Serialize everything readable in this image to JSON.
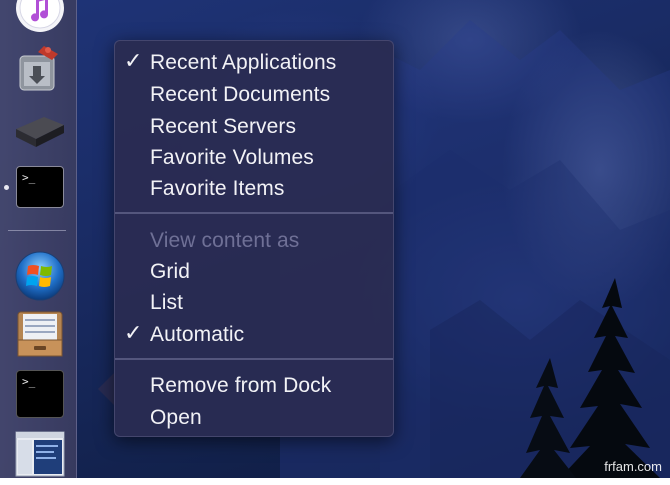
{
  "dock": {
    "apps": [
      {
        "name": "itunes-icon"
      },
      {
        "name": "installer-icon"
      },
      {
        "name": "server-drive-icon"
      },
      {
        "name": "terminal-icon",
        "text": ">_"
      },
      {
        "name": "windows-icon"
      },
      {
        "name": "drawer-icon"
      },
      {
        "name": "terminal-window-icon",
        "text": ">_"
      },
      {
        "name": "finder-window-thumbnail-icon"
      }
    ]
  },
  "menu": {
    "items": [
      {
        "label": "Recent Applications",
        "checked": true
      },
      {
        "label": "Recent Documents"
      },
      {
        "label": "Recent Servers"
      },
      {
        "label": "Favorite Volumes"
      },
      {
        "label": "Favorite Items"
      },
      {
        "label": "View content as",
        "disabled": true
      },
      {
        "label": "Grid"
      },
      {
        "label": "List"
      },
      {
        "label": "Automatic",
        "checked": true
      },
      {
        "label": "Remove from Dock"
      },
      {
        "label": "Open"
      }
    ],
    "check_glyph": "✓"
  },
  "watermark": "frfam.com"
}
